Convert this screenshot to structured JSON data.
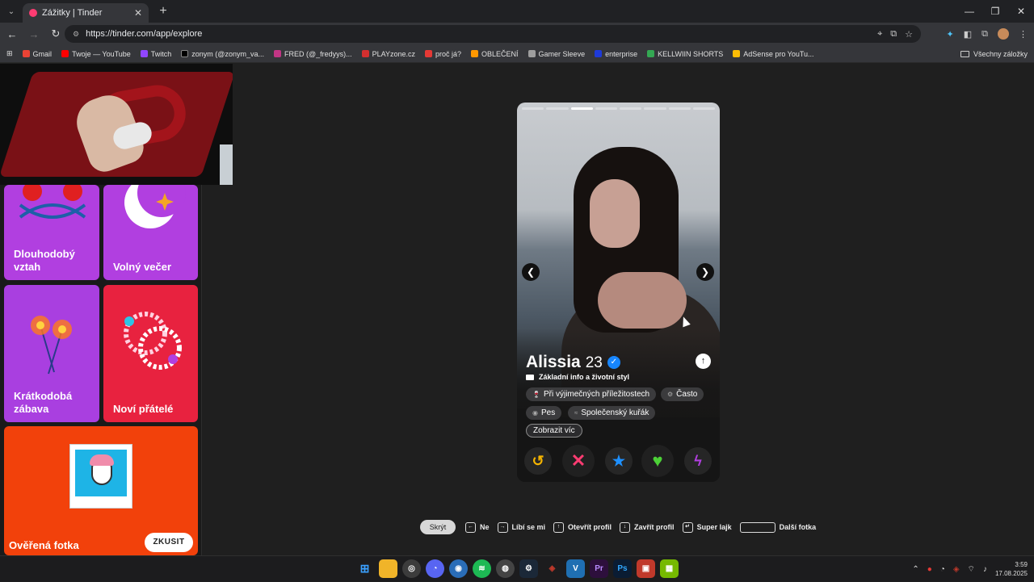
{
  "browser": {
    "tab_title": "Zážitky | Tinder",
    "url": "https://tinder.com/app/explore",
    "bookmarks": [
      "Gmail",
      "Twoje — YouTube",
      "Twitch",
      "zonym (@zonym_va...",
      "FRED (@_fredyys)...",
      "PLAYzone.cz",
      "proč já?",
      "OBLEČENÍ",
      "Gamer Sleeve",
      "enterprise",
      "KELLWIIN SHORTS",
      "AdSense pro YouTu..."
    ],
    "all_bookmarks": "Všechny záložky"
  },
  "sidebar": {
    "tiles": [
      {
        "label": "Dlouhodobý vztah",
        "color": "#b13fe0"
      },
      {
        "label": "Volný večer",
        "color": "#b13fe0"
      },
      {
        "label": "Krátkodobá zábava",
        "color": "#a93fe0"
      },
      {
        "label": "Noví přátelé",
        "color": "#e8223f"
      },
      {
        "label": "Ověřená fotka",
        "color": "#f2410b",
        "button": "ZKUSIT"
      }
    ]
  },
  "profile": {
    "name": "Alissia",
    "age": "23",
    "section_title": "Základní info a životní styl",
    "chips": [
      {
        "icon": "drink-icon",
        "label": "Při výjimečných příležitostech"
      },
      {
        "icon": "workout-icon",
        "label": "Často"
      },
      {
        "icon": "pet-icon",
        "label": "Pes"
      },
      {
        "icon": "smoking-icon",
        "label": "Společenský kuřák"
      }
    ],
    "show_more": "Zobrazit víc",
    "photo_count": 8,
    "active_photo": 3
  },
  "actions": [
    {
      "name": "rewind-button",
      "glyph": "↺",
      "color": "#f5b400"
    },
    {
      "name": "nope-button",
      "glyph": "✕",
      "color": "#fe3c72"
    },
    {
      "name": "super-like-button",
      "glyph": "★",
      "color": "#1e90ff"
    },
    {
      "name": "like-button",
      "glyph": "♥",
      "color": "#4cd137"
    },
    {
      "name": "boost-button",
      "glyph": "ϟ",
      "color": "#b13fe0"
    }
  ],
  "hints": {
    "hide": "Skrýt",
    "items": [
      "Ne",
      "Líbí se mi",
      "Otevřít profil",
      "Zavřít profil",
      "Super lajk",
      "Další fotka"
    ]
  },
  "taskbar": {
    "time": "3:59",
    "date": "17.08.2025"
  }
}
